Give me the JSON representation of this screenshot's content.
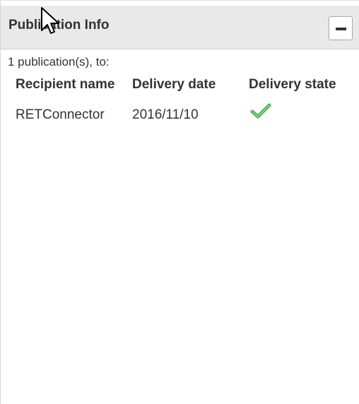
{
  "panel": {
    "title": "Publication Info",
    "collapse_label": "−"
  },
  "summary": "1 publication(s), to:",
  "table": {
    "columns": [
      "Recipient name",
      "Delivery date",
      "Delivery state"
    ],
    "rows": [
      {
        "recipient": "RETConnector",
        "delivery_date": "2016/11/10",
        "delivery_state_icon": "check-icon",
        "delivery_state_color": "#4caf50"
      }
    ]
  },
  "icons": {
    "collapse": "minus-icon",
    "cursor": "mouse-pointer-icon"
  },
  "colors": {
    "header_bg": "#e9e9e9",
    "text": "#333333",
    "success": "#4caf50"
  }
}
